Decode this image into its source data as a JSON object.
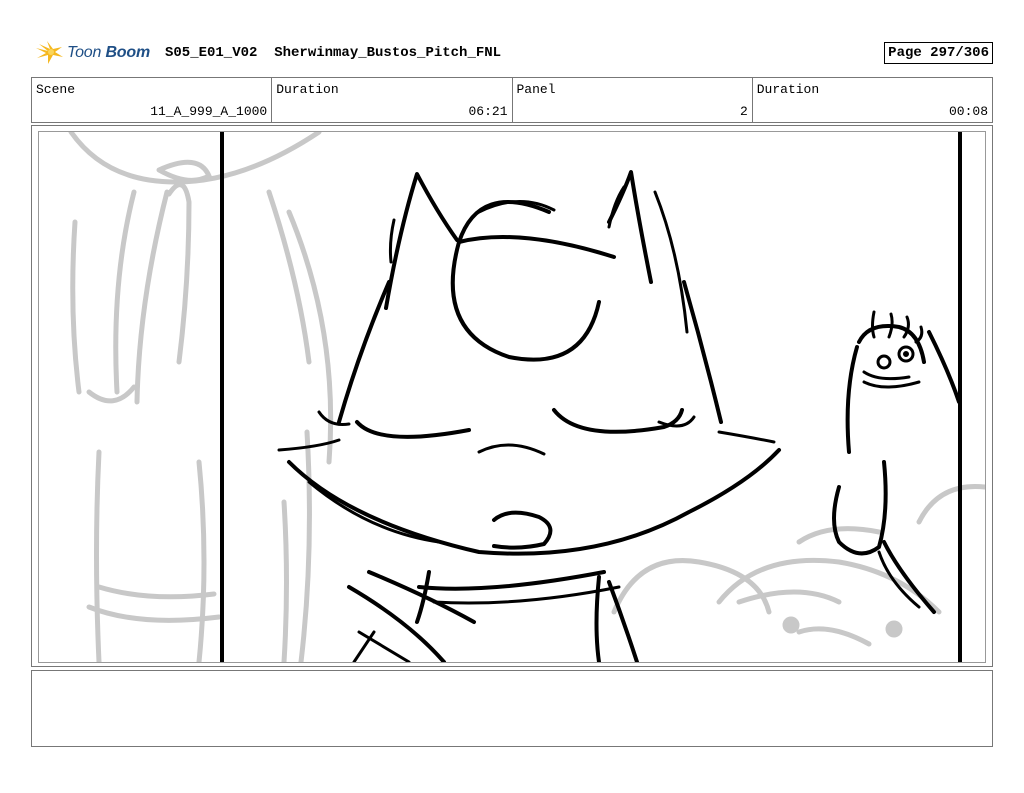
{
  "header": {
    "logo_word1": "Toon",
    "logo_word2": "Boom",
    "doc_title": "S05_E01_V02  Sherwinmay_Bustos_Pitch_FNL",
    "page": "Page 297/306"
  },
  "info": {
    "scene_label": "Scene",
    "scene_value": "11_A_999_A_1000",
    "scene_duration_label": "Duration",
    "scene_duration_value": "06:21",
    "panel_label": "Panel",
    "panel_value": "2",
    "panel_duration_label": "Duration",
    "panel_duration_value": "00:08"
  },
  "colors": {
    "logo_blue": "#1f4f86",
    "logo_yellow": "#f5b820",
    "sketch_gray": "#c8c8c8",
    "ink": "#000000"
  },
  "icons": {
    "logo": "toon-boom-star-icon"
  },
  "notes": ""
}
